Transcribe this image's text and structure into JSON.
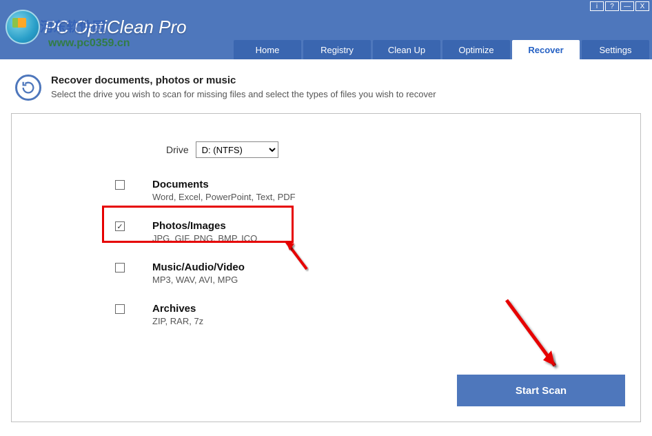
{
  "window": {
    "title": "PC OptiClean Pro",
    "watermark_url": "www.pc0359.cn",
    "watermark_cn": "河东软件园"
  },
  "tabs": {
    "home": "Home",
    "registry": "Registry",
    "cleanup": "Clean Up",
    "optimize": "Optimize",
    "recover": "Recover",
    "settings": "Settings"
  },
  "intro": {
    "heading": "Recover documents, photos or music",
    "sub": "Select the drive you wish to scan for missing files and select the types of files you wish to recover"
  },
  "drive": {
    "label": "Drive",
    "selected": "D: (NTFS)"
  },
  "categories": {
    "documents": {
      "title": "Documents",
      "desc": "Word, Excel, PowerPoint, Text, PDF",
      "checked": false
    },
    "photos": {
      "title": "Photos/Images",
      "desc": "JPG, GIF, PNG, BMP, ICO",
      "checked": true
    },
    "music": {
      "title": "Music/Audio/Video",
      "desc": "MP3, WAV, AVI, MPG",
      "checked": false
    },
    "archives": {
      "title": "Archives",
      "desc": "ZIP, RAR, 7z",
      "checked": false
    }
  },
  "buttons": {
    "start_scan": "Start Scan"
  }
}
